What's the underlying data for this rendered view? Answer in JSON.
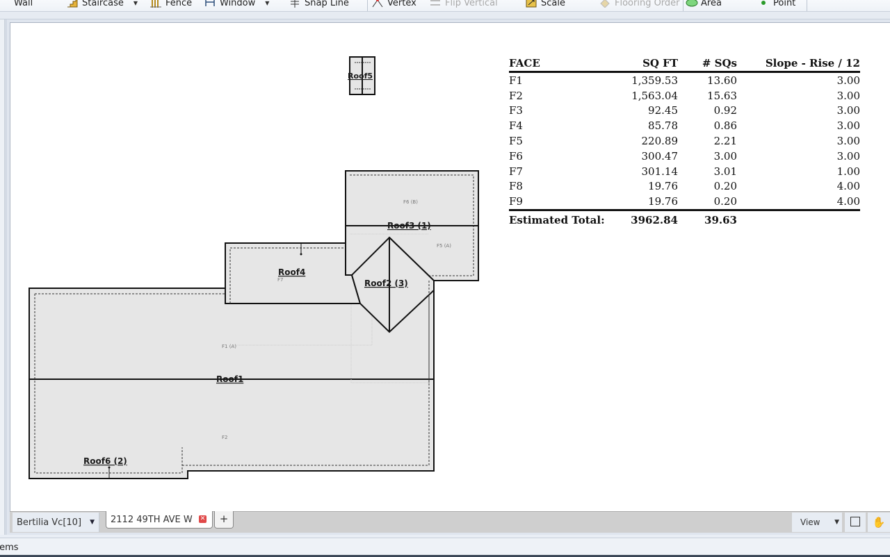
{
  "toolbar": {
    "items": [
      {
        "label": "Wall",
        "icon": "wall-icon",
        "enabled": true
      },
      {
        "label": "Staircase",
        "icon": "staircase-icon",
        "enabled": true,
        "has_dropdown": true
      },
      {
        "label": "Fence",
        "icon": "fence-icon",
        "enabled": true
      },
      {
        "label": "Window",
        "icon": "window-icon",
        "enabled": true,
        "has_dropdown": true
      },
      {
        "label": "Snap Line",
        "icon": "snap-line-icon",
        "enabled": true
      },
      {
        "label": "Vertex",
        "icon": "vertex-icon",
        "enabled": true
      },
      {
        "label": "Flip Vertical",
        "icon": "flip-vertical-icon",
        "enabled": false
      },
      {
        "label": "Scale",
        "icon": "scale-icon",
        "enabled": true
      },
      {
        "label": "Flooring Order",
        "icon": "flooring-order-icon",
        "enabled": false
      },
      {
        "label": "Area",
        "icon": "area-icon",
        "enabled": true
      },
      {
        "label": "Point",
        "icon": "point-icon",
        "enabled": true
      }
    ]
  },
  "drawing": {
    "roof_labels": [
      "Roof1",
      "Roof2  (3)",
      "Roof3  (1)",
      "Roof4",
      "Roof5",
      "Roof6  (2)"
    ],
    "face_labels": [
      "F1 (A)",
      "F2",
      "F5 (A)",
      "F6 (B)",
      "F7"
    ],
    "colors": {
      "roof_fill": "#e6e6e6",
      "outline": "#111111"
    }
  },
  "area_table": {
    "headers": [
      "FACE",
      "SQ FT",
      "# SQs",
      "Slope - Rise / 12"
    ],
    "rows": [
      {
        "face": "F1",
        "sqft": "1,359.53",
        "sqs": "13.60",
        "slope": "3.00"
      },
      {
        "face": "F2",
        "sqft": "1,563.04",
        "sqs": "15.63",
        "slope": "3.00"
      },
      {
        "face": "F3",
        "sqft": "92.45",
        "sqs": "0.92",
        "slope": "3.00"
      },
      {
        "face": "F4",
        "sqft": "85.78",
        "sqs": "0.86",
        "slope": "3.00"
      },
      {
        "face": "F5",
        "sqft": "220.89",
        "sqs": "2.21",
        "slope": "3.00"
      },
      {
        "face": "F6",
        "sqft": "300.47",
        "sqs": "3.00",
        "slope": "3.00"
      },
      {
        "face": "F7",
        "sqft": "301.14",
        "sqs": "3.01",
        "slope": "1.00"
      },
      {
        "face": "F8",
        "sqft": "19.76",
        "sqs": "0.20",
        "slope": "4.00"
      },
      {
        "face": "F9",
        "sqft": "19.76",
        "sqs": "0.20",
        "slope": "4.00"
      }
    ],
    "total": {
      "label": "Estimated Total:",
      "sqft": "3962.84",
      "sqs": "39.63"
    }
  },
  "bottom_bar": {
    "layer_select": "Bertilia Vc[10]",
    "doc_tab": "2112 49TH AVE W",
    "add_tab": "+",
    "view_button": "View"
  },
  "status_bar": {
    "text": "tems"
  }
}
